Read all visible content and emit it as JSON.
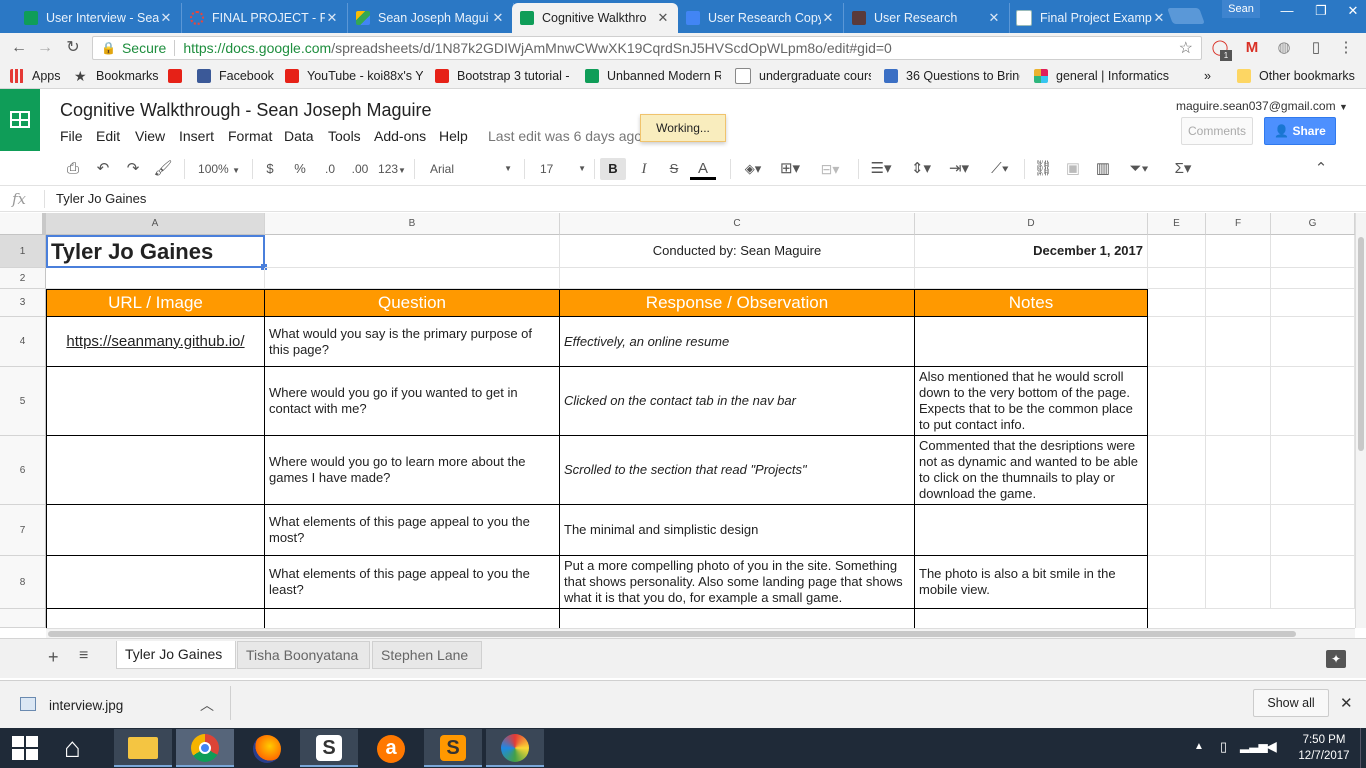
{
  "browser": {
    "tabs": [
      {
        "label": "User Interview - Sea",
        "active": false
      },
      {
        "label": "FINAL PROJECT - Pa",
        "active": false
      },
      {
        "label": "Sean Joseph Magui",
        "active": false
      },
      {
        "label": "Cognitive Walkthro",
        "active": true
      },
      {
        "label": "User Research Copy",
        "active": false
      },
      {
        "label": "User Research",
        "active": false
      },
      {
        "label": "Final Project Examp",
        "active": false
      }
    ],
    "profile_name": "Sean",
    "secure_label": "Secure",
    "url_host": "https://docs.google.com",
    "url_path": "/spreadsheets/d/1N87k2GDIWjAmMnwCWwXK19CqrdSnJ5HVScdOpWLpm8o/edit#gid=0",
    "extension_badge": "1",
    "bookmarks": [
      {
        "label": "Apps",
        "icon": "apps-icon"
      },
      {
        "label": "Bookmarks",
        "icon": "star-icon"
      },
      {
        "label": "",
        "icon": "youtube-icon"
      },
      {
        "label": "Facebook",
        "icon": "facebook-icon"
      },
      {
        "label": "YouTube - koi88x's Y",
        "icon": "youtube-icon"
      },
      {
        "label": "Bootstrap 3 tutorial -",
        "icon": "youtube-icon"
      },
      {
        "label": "Unbanned Modern R",
        "icon": "sheets-icon"
      },
      {
        "label": "undergraduate cours",
        "icon": "page-icon"
      },
      {
        "label": "36 Questions to Bring",
        "icon": "pt-icon"
      },
      {
        "label": "general | Informatics",
        "icon": "slack-icon"
      }
    ],
    "bookmarks_overflow": "»",
    "other_bookmarks": "Other bookmarks"
  },
  "doc": {
    "title": "Cognitive Walkthrough - Sean Joseph Maguire",
    "menus": [
      "File",
      "Edit",
      "View",
      "Insert",
      "Format",
      "Data",
      "Tools",
      "Add-ons",
      "Help"
    ],
    "last_edit": "Last edit was 6 days ago",
    "working": "Working...",
    "account": "maguire.sean037@gmail.com",
    "comments_label": "Comments",
    "share_label": "Share"
  },
  "format_toolbar": {
    "zoom": "100%",
    "currency": "$",
    "percent": "%",
    "dec_decrease": ".0",
    "dec_increase": ".00",
    "more_formats": "123",
    "font": "Arial",
    "font_size": "17",
    "bold": "B",
    "italic": "I",
    "strike": "S",
    "text_color": "A"
  },
  "formula_bar": {
    "label": "fx",
    "value": "Tyler Jo Gaines"
  },
  "grid": {
    "columns": [
      "A",
      "B",
      "C",
      "D",
      "E",
      "F",
      "G"
    ],
    "rows": [
      "1",
      "2",
      "3",
      "4",
      "5",
      "6",
      "7",
      "8"
    ],
    "r1": {
      "name": "Tyler Jo Gaines",
      "conducted": "Conducted by: Sean Maguire",
      "date": "December 1, 2017"
    },
    "headers": [
      "URL / Image",
      "Question",
      "Response / Observation",
      "Notes"
    ],
    "data": [
      {
        "url": "https://seanmany.github.io/",
        "question": "What would you say is the primary purpose of this page?",
        "response": "Effectively, an online resume",
        "notes": ""
      },
      {
        "url": "",
        "question": "Where would you go if you wanted to get in contact with me?",
        "response": "Clicked on the contact tab in the nav bar",
        "notes": "Also mentioned that he would scroll down to the very bottom of the page. Expects that to be the common place to put contact info."
      },
      {
        "url": "",
        "question": "Where would you go to learn more about the games I have made?",
        "response": "Scrolled to the section that read \"Projects\"",
        "notes": "Commented that the desriptions were not as dynamic and wanted to be able to click on the thumnails to play or download the game."
      },
      {
        "url": "",
        "question": "What elements of this page appeal to you the most?",
        "response": "The minimal and simplistic design",
        "notes": ""
      },
      {
        "url": "",
        "question": "What elements of this page appeal to you the least?",
        "response": "Put a more compelling photo of you in the site. Something that shows personality. Also some landing page that shows what it is that you do, for example a small game.",
        "notes": "The photo is also a bit smile in the mobile view."
      }
    ]
  },
  "sheets": [
    "Tyler Jo Gaines",
    "Tisha Boonyatana",
    "Stephen Lane"
  ],
  "downloads": {
    "file": "interview.jpg",
    "show_all": "Show all"
  },
  "taskbar": {
    "time": "7:50 PM",
    "date": "12/7/2017"
  },
  "colors": {
    "header_orange": "#ff9900",
    "sheets_green": "#0f9d58",
    "share_blue": "#4d90fe",
    "chrome_blue": "#2b78c5"
  }
}
